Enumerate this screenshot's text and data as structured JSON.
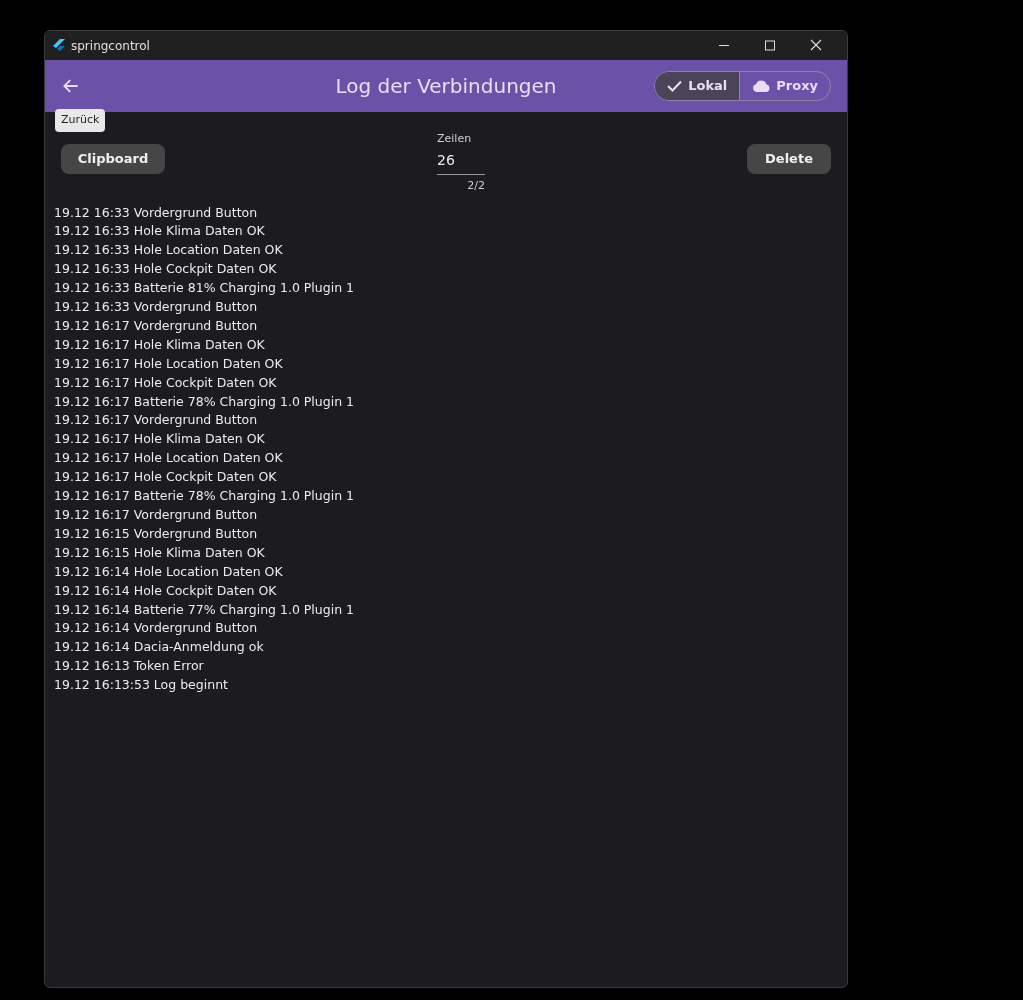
{
  "window": {
    "title": "springcontrol"
  },
  "app_bar": {
    "title": "Log der Verbindungen",
    "back_tooltip": "Zurück",
    "segments": [
      {
        "label": "Lokal",
        "selected": true
      },
      {
        "label": "Proxy",
        "selected": false
      }
    ]
  },
  "toolbar": {
    "clipboard_button": "Clipboard",
    "delete_button": "Delete",
    "rows_field": {
      "label": "Zeilen",
      "value": "26",
      "counter": "2/2"
    }
  },
  "log_lines": [
    "19.12 16:33 Vordergrund Button",
    "19.12 16:33 Hole Klima Daten OK",
    "19.12 16:33 Hole Location Daten OK",
    "19.12 16:33 Hole Cockpit Daten OK",
    "19.12 16:33 Batterie 81% Charging 1.0 Plugin 1",
    "19.12 16:33 Vordergrund Button",
    "19.12 16:17 Vordergrund Button",
    "19.12 16:17 Hole Klima Daten OK",
    "19.12 16:17 Hole Location Daten OK",
    "19.12 16:17 Hole Cockpit Daten OK",
    "19.12 16:17 Batterie 78% Charging 1.0 Plugin 1",
    "19.12 16:17 Vordergrund Button",
    "19.12 16:17 Hole Klima Daten OK",
    "19.12 16:17 Hole Location Daten OK",
    "19.12 16:17 Hole Cockpit Daten OK",
    "19.12 16:17 Batterie 78% Charging 1.0 Plugin 1",
    "19.12 16:17 Vordergrund Button",
    "19.12 16:15 Vordergrund Button",
    "19.12 16:15 Hole Klima Daten OK",
    "19.12 16:14 Hole Location Daten OK",
    "19.12 16:14 Hole Cockpit Daten OK",
    "19.12 16:14 Batterie 77% Charging 1.0 Plugin 1",
    "19.12 16:14 Vordergrund Button",
    "19.12 16:14 Dacia-Anmeldung ok",
    "19.12 16:13 Token Error",
    "19.12 16:13:53 Log beginnt"
  ]
}
